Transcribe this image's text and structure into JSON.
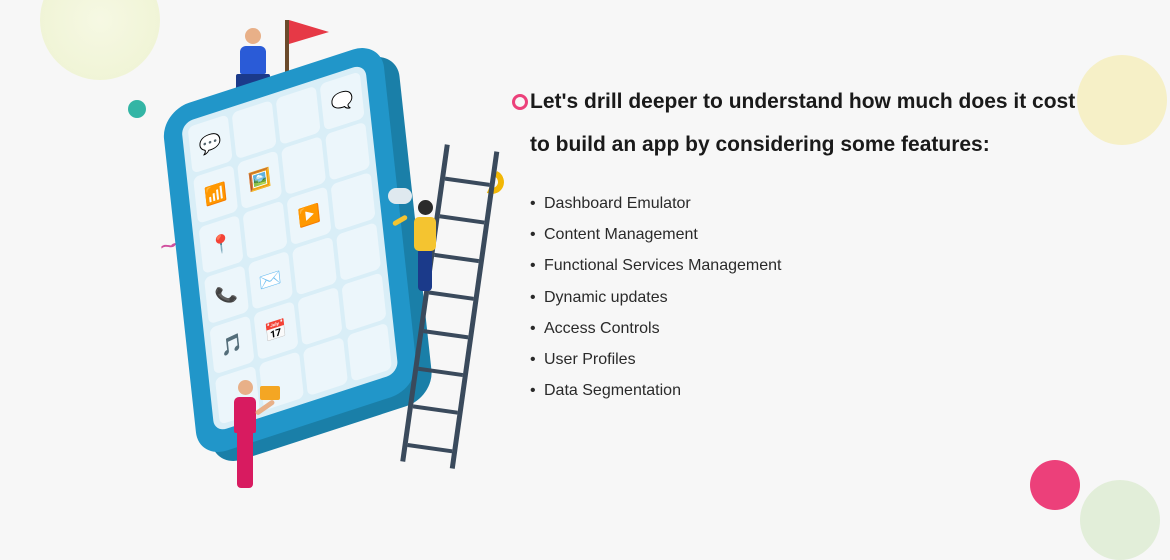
{
  "heading": "Let's drill deeper to understand how much does it cost to build an app by considering some features:",
  "features": {
    "item0": "Dashboard Emulator",
    "item1": "Content Management",
    "item2": "Functional Services Management",
    "item3": "Dynamic updates",
    "item4": "Access Controls",
    "item5": "User Profiles",
    "item6": "Data Segmentation"
  },
  "colors": {
    "accent": "#ec407a",
    "tablet": "#2196c9"
  }
}
